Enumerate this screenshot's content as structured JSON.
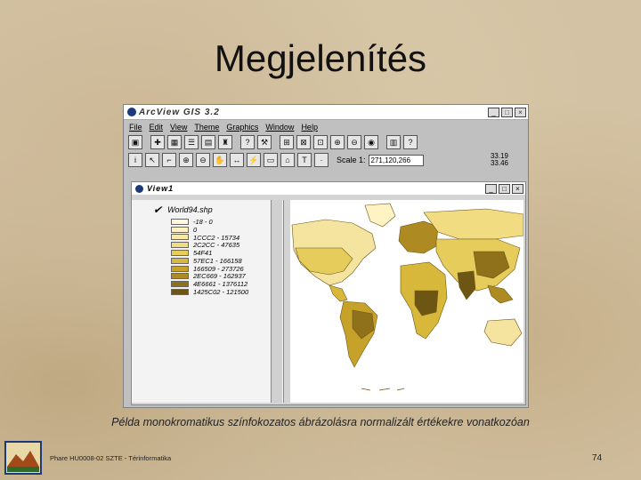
{
  "slide": {
    "title": "Megjelenítés",
    "caption": "Példa monokromatikus színfokozatos ábrázolásra normalizált értékekre vonatkozóan",
    "footer": "Phare HU0008-02 SZTE - Térinformatika",
    "page_number": "74"
  },
  "app": {
    "title": "ArcView GIS 3.2",
    "window_buttons": [
      "_",
      "□",
      "×"
    ],
    "menu": [
      "File",
      "Edit",
      "View",
      "Theme",
      "Graphics",
      "Window",
      "Help"
    ],
    "scale_label": "Scale 1:",
    "scale_value": "271,120,266",
    "coords": [
      "33.19",
      "33.46"
    ],
    "toolbar1_icons": [
      "save-icon",
      "add-theme-icon",
      "table-icon",
      "properties-icon",
      "theme-icon",
      "find-icon",
      "query-icon",
      "query-builder-icon",
      "zoom-full-icon",
      "zoom-active-icon",
      "zoom-selected-icon",
      "zoom-in-icon",
      "zoom-out-icon",
      "zoom-previous-icon",
      "layout-icon",
      "help-icon"
    ],
    "toolbar2_icons": [
      "info-icon",
      "pointer-icon",
      "vertex-icon",
      "zoom-tool-icon",
      "zoom-out-tool-icon",
      "pan-icon",
      "measure-icon",
      "hotlink-icon",
      "area-select-icon",
      "label-icon",
      "text-icon",
      "draw-icon"
    ]
  },
  "view": {
    "title": "View1",
    "layer": "World94.shp",
    "legend": [
      {
        "label": "-18 - 0",
        "color": "#fff8dc"
      },
      {
        "label": "0",
        "color": "#fff3c4"
      },
      {
        "label": "1CCC2 - 15734",
        "color": "#f8e9a6"
      },
      {
        "label": "2C2CC - 47635",
        "color": "#f1dc82"
      },
      {
        "label": "54F41",
        "color": "#e6cc5a"
      },
      {
        "label": "57EC1 - 166158",
        "color": "#d8b83a"
      },
      {
        "label": "166509 - 273726",
        "color": "#c6a22a"
      },
      {
        "label": "2EC669 - 162937",
        "color": "#ad8a22"
      },
      {
        "label": "4E6661 - 1376112",
        "color": "#8f711c"
      },
      {
        "label": "1425C02 - 121500",
        "color": "#6d5613"
      }
    ]
  }
}
